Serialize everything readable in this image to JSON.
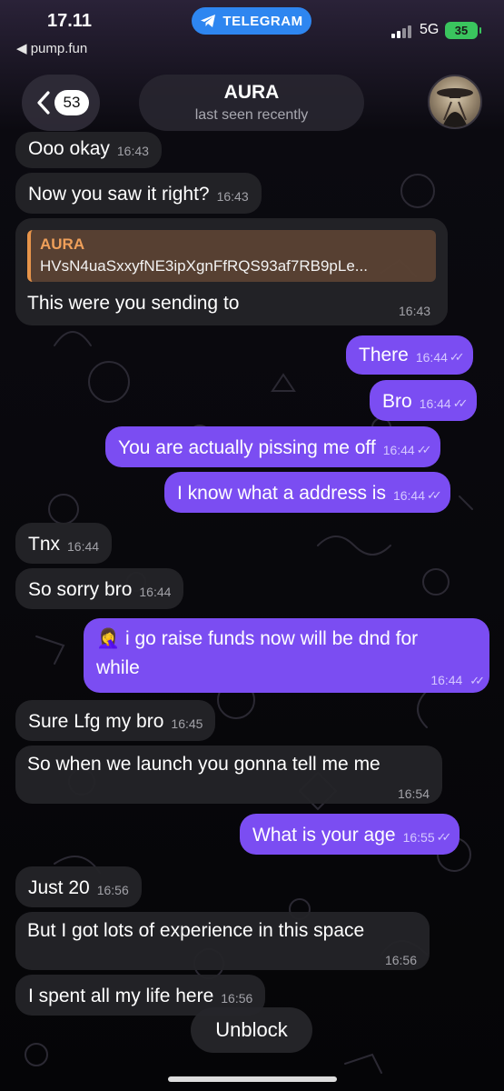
{
  "status_bar": {
    "time": "17.11",
    "back_app": "◀ pump.fun",
    "pill_label": "TELEGRAM",
    "network": "5G",
    "battery": "35"
  },
  "header": {
    "back_count": "53",
    "name": "AURA",
    "status": "last seen recently"
  },
  "colors": {
    "outgoing_bubble": "#7b4df2",
    "incoming_bubble": "#242428",
    "telegram_pill": "#2e86f0",
    "quote_accent": "#e7944a",
    "battery": "#3ac55e"
  },
  "messages": [
    {
      "dir": "in",
      "text": "Ooo okay",
      "time": "16:43"
    },
    {
      "dir": "in",
      "text": "Now you saw it right?",
      "time": "16:43"
    },
    {
      "dir": "in",
      "text": "This were you sending to",
      "time": "16:43",
      "reply_to": {
        "name": "AURA",
        "text": "HVsN4uaSxxyfNE3ipXgnFfRQS93af7RB9pLe..."
      }
    },
    {
      "dir": "out",
      "text": "There",
      "time": "16:44",
      "read": true
    },
    {
      "dir": "out",
      "text": "Bro",
      "time": "16:44",
      "read": true
    },
    {
      "dir": "out",
      "text": "You are actually pissing me off",
      "time": "16:44",
      "read": true
    },
    {
      "dir": "out",
      "text": "I know what a address is",
      "time": "16:44",
      "read": true
    },
    {
      "dir": "in",
      "text": "Tnx",
      "time": "16:44"
    },
    {
      "dir": "in",
      "text": "So sorry bro",
      "time": "16:44"
    },
    {
      "dir": "out",
      "text": "🤦‍♀️ i go raise funds now will be dnd for while",
      "emoji": "🤦‍♀️",
      "line1": "i go raise funds now will be dnd for",
      "line2": "while",
      "time": "16:44",
      "read": true
    },
    {
      "dir": "in",
      "text": "Sure Lfg my bro",
      "time": "16:45"
    },
    {
      "dir": "in",
      "text": "So when we launch you gonna tell me me",
      "time": "16:54"
    },
    {
      "dir": "out",
      "text": "What is your age",
      "time": "16:55",
      "read": true
    },
    {
      "dir": "in",
      "text": "Just 20",
      "time": "16:56"
    },
    {
      "dir": "in",
      "text": "But I got lots of experience in this space",
      "time": "16:56"
    },
    {
      "dir": "in",
      "text": "I spent all my life here",
      "time": "16:56"
    }
  ],
  "footer": {
    "unblock_label": "Unblock"
  }
}
